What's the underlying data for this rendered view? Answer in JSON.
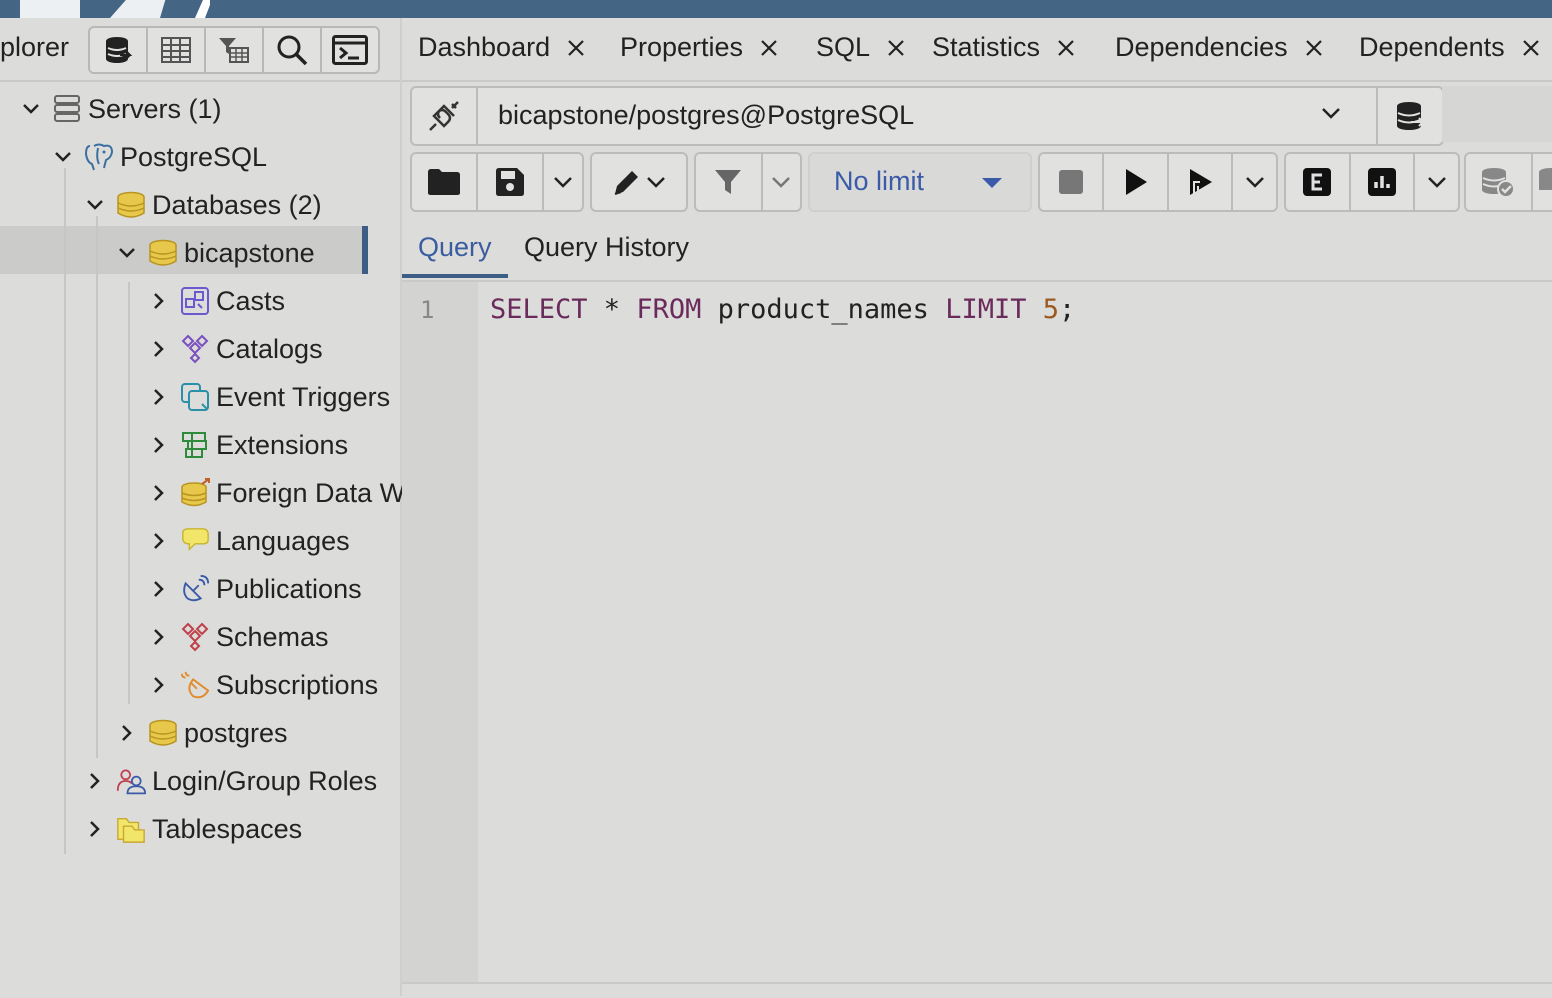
{
  "explorer": {
    "title": "plorer",
    "tools": [
      "database-icon",
      "table-icon",
      "filtered-rows-icon",
      "search-icon",
      "psql-tool-icon"
    ]
  },
  "tree": {
    "servers": "Servers (1)",
    "server": "PostgreSQL",
    "databases": "Databases (2)",
    "selected_db": "bicapstone",
    "children": [
      "Casts",
      "Catalogs",
      "Event Triggers",
      "Extensions",
      "Foreign Data W",
      "Languages",
      "Publications",
      "Schemas",
      "Subscriptions"
    ],
    "other_db": "postgres",
    "login_roles": "Login/Group Roles",
    "tablespaces": "Tablespaces"
  },
  "tabs": [
    "Dashboard",
    "Properties",
    "SQL",
    "Statistics",
    "Dependencies",
    "Dependents"
  ],
  "connection": {
    "value": "bicapstone/postgres@PostgreSQL"
  },
  "toolbar": {
    "limit_label": "No limit"
  },
  "query_tabs": {
    "query": "Query",
    "history": "Query History"
  },
  "editor": {
    "line_number": "1",
    "tokens": {
      "select": "SELECT",
      "star": " * ",
      "from": "FROM",
      "table": " product_names ",
      "limit": "LIMIT",
      "space": " ",
      "num": "5",
      "semi": ";"
    }
  },
  "colors": {
    "accent": "#3b5d86",
    "link": "#3b5ba8",
    "keyword": "#6b2a5c",
    "topbar": "#456584"
  }
}
